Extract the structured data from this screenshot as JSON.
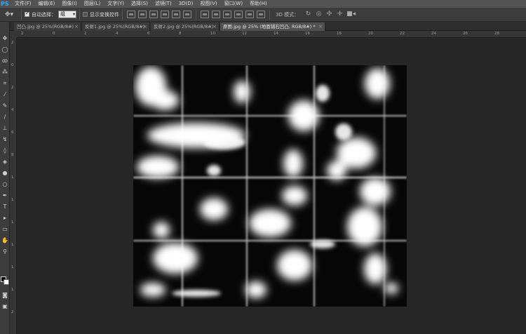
{
  "app": {
    "logo": "PS"
  },
  "menu": [
    "文件(F)",
    "编辑(E)",
    "图像(I)",
    "图层(L)",
    "文字(Y)",
    "选择(S)",
    "滤镜(T)",
    "3D(D)",
    "视图(V)",
    "窗口(W)",
    "帮助(H)"
  ],
  "options": {
    "tool_icon": "move-tool-icon",
    "auto_select_label": "自动选择：",
    "auto_select_value": "组",
    "transform_label": "显示变换控件",
    "mode3d_label": "3D 模式："
  },
  "tabs": [
    {
      "label": "凹凸.jpg @ 25%(RGB/8#)",
      "close": "×",
      "active": false
    },
    {
      "label": "反射1.jpg @ 25%(RGB/8#)",
      "close": "×",
      "active": false
    },
    {
      "label": "反射2.jpg @ 25%(RGB/8#)",
      "close": "×",
      "active": false
    },
    {
      "label": "原图.jpg @ 25% (地面铺石凹凸, RGB/8#) *",
      "close": "×",
      "active": true
    }
  ],
  "ruler_h_labels": [
    "2",
    "0",
    "2",
    "4",
    "6",
    "8",
    "10",
    "12",
    "14",
    "16",
    "18",
    "20",
    "22",
    "24",
    "26",
    "28"
  ],
  "ruler_v_labels": [
    "2",
    "0",
    "2",
    "4",
    "6",
    "8",
    "1",
    "1",
    "1",
    "1",
    "1",
    "1",
    "2"
  ],
  "colors": {
    "menubar": "#535353",
    "optionsbar": "#3c3c3c",
    "workspace": "#262626",
    "canvas": "#050505",
    "logo": "#31a8ff"
  }
}
